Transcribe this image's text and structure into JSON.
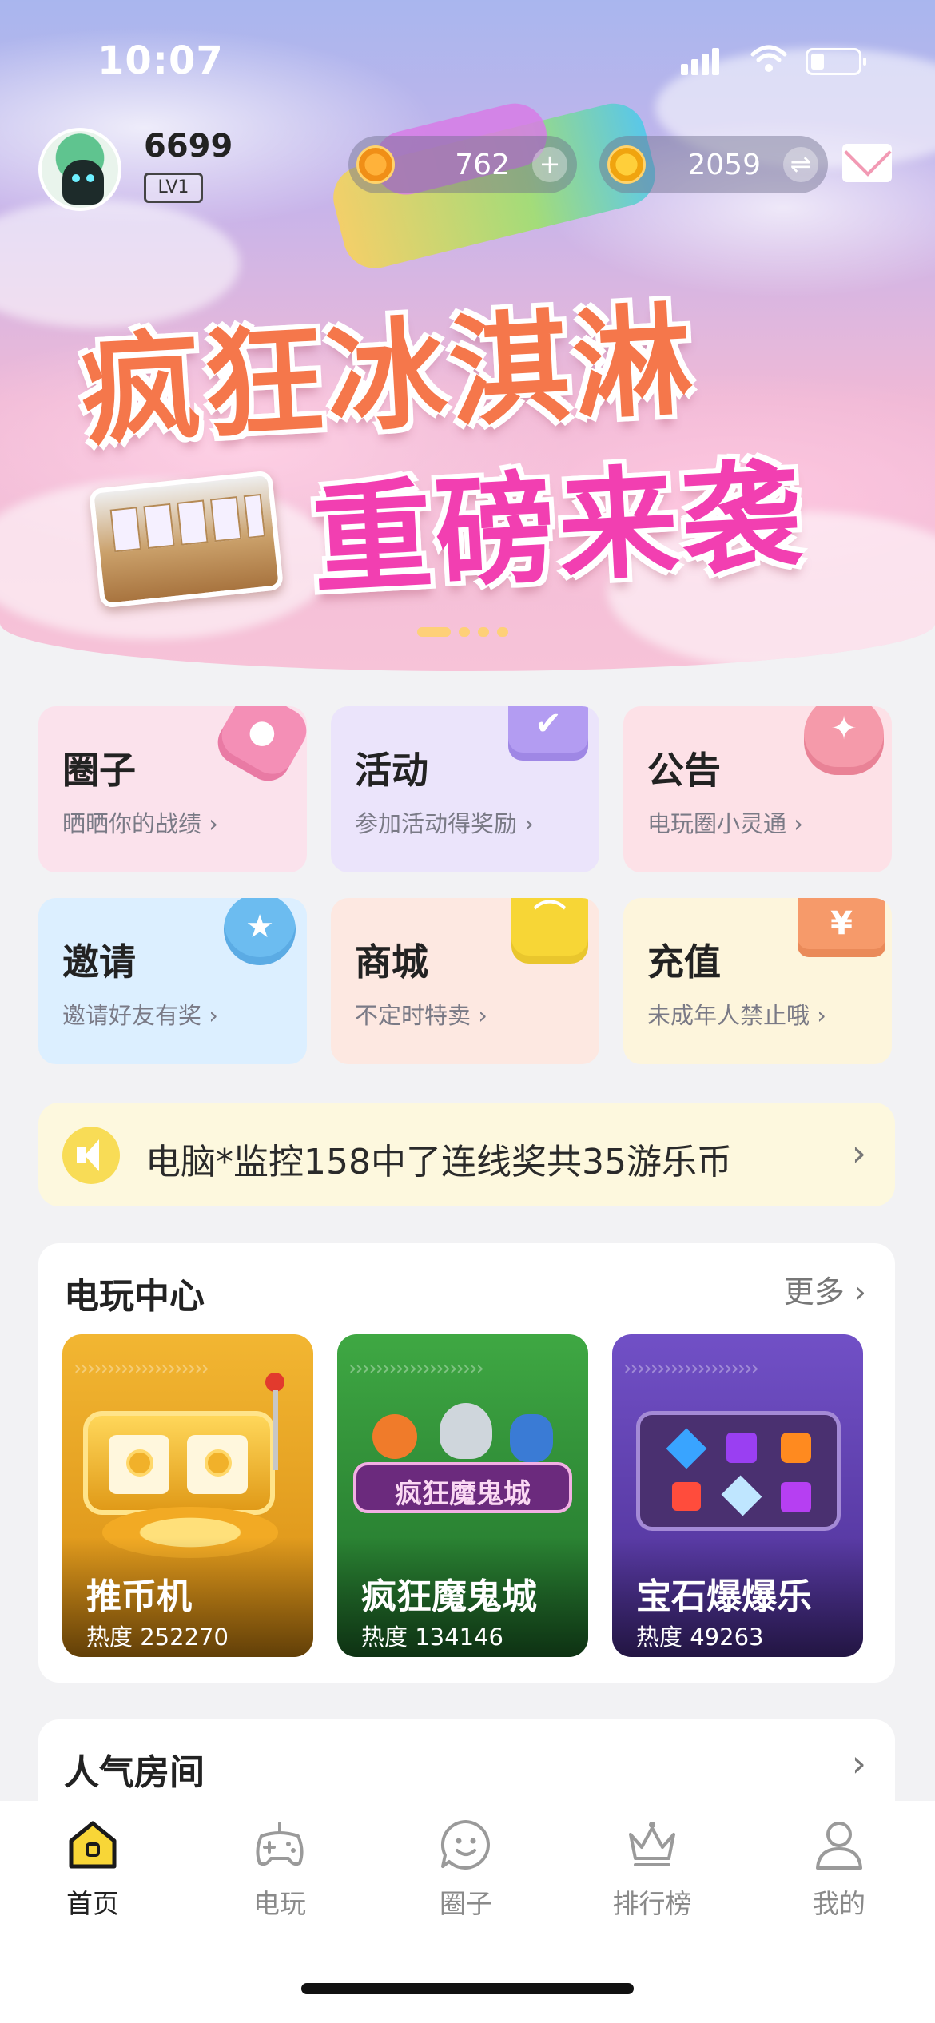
{
  "status_bar": {
    "time": "10:07"
  },
  "profile": {
    "username": "6699",
    "level": "LV1"
  },
  "currency": {
    "coins": "762",
    "gems": "2059",
    "add_icon": "plus-icon",
    "exchange_icon": "exchange-icon"
  },
  "banner": {
    "line1": "疯狂冰淇淋",
    "line2": "重磅来袭",
    "active_slide": 1,
    "slide_count": 4
  },
  "features": [
    {
      "title": "圈子",
      "subtitle": "晒晒你的战绩 ›",
      "color": "#fbe2ec",
      "icon": "hexagon-icon"
    },
    {
      "title": "活动",
      "subtitle": "参加活动得奖励 ›",
      "color": "#ebe4fb",
      "icon": "check-chat-icon"
    },
    {
      "title": "公告",
      "subtitle": "电玩圈小灵通 ›",
      "color": "#fde1e7",
      "icon": "sparkle-flower-icon"
    },
    {
      "title": "邀请",
      "subtitle": "邀请好友有奖 ›",
      "color": "#dcefff",
      "icon": "medal-icon"
    },
    {
      "title": "商城",
      "subtitle": "不定时特卖 ›",
      "color": "#fde8e1",
      "icon": "shopping-bag-icon"
    },
    {
      "title": "充值",
      "subtitle": "未成年人禁止哦 ›",
      "color": "#fdf5dc",
      "icon": "yuan-ticket-icon"
    }
  ],
  "marquee": {
    "message": "电脑*监控158中了连线奖共35游乐币"
  },
  "game_center": {
    "title": "电玩中心",
    "more": "更多",
    "games": [
      {
        "name": "推币机",
        "heat": "热度 252270",
        "color": "#e8a21c"
      },
      {
        "name": "疯狂魔鬼城",
        "heat": "热度 134146",
        "color": "#2f9a3b"
      },
      {
        "name": "宝石爆爆乐",
        "heat": "热度 49263",
        "color": "#6a47b8"
      }
    ]
  },
  "popular_rooms": {
    "title": "人气房间"
  },
  "tabbar": [
    {
      "label": "首页",
      "icon": "home-icon",
      "active": true
    },
    {
      "label": "电玩",
      "icon": "gamepad-icon",
      "active": false
    },
    {
      "label": "圈子",
      "icon": "smiley-chat-icon",
      "active": false
    },
    {
      "label": "排行榜",
      "icon": "crown-icon",
      "active": false
    },
    {
      "label": "我的",
      "icon": "person-icon",
      "active": false
    }
  ]
}
